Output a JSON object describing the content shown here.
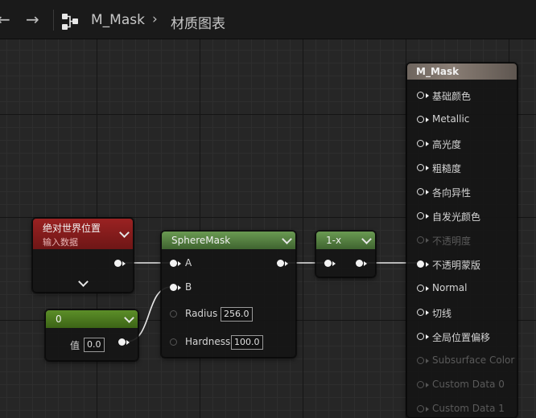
{
  "breadcrumb": {
    "back_icon": "arrow-left-icon",
    "forward_icon": "arrow-right-icon",
    "graph_icon": "graph-nodes-icon",
    "asset_name": "M_Mask",
    "separator": "›",
    "graph_name": "材质图表"
  },
  "nodes": {
    "absolute_world_position": {
      "title": "绝对世界位置",
      "subtitle": "输入数据",
      "header_color": "#8a1d1d"
    },
    "sphere_mask": {
      "title": "SphereMask",
      "header_color": "#4f7a3e",
      "pins": {
        "a": "A",
        "b": "B",
        "radius": "Radius",
        "radius_value": "256.0",
        "hardness": "Hardness",
        "hardness_value": "100.0"
      }
    },
    "constant": {
      "title": "0",
      "value_label": "值",
      "value": "0.0",
      "header_color": "#4c7a20"
    },
    "one_minus": {
      "title": "1-x",
      "header_color": "#4f7a3e"
    },
    "result": {
      "title": "M_Mask",
      "pins": [
        {
          "label": "基础颜色",
          "active": true
        },
        {
          "label": "Metallic",
          "active": true
        },
        {
          "label": "高光度",
          "active": true
        },
        {
          "label": "粗糙度",
          "active": true
        },
        {
          "label": "各向异性",
          "active": true
        },
        {
          "label": "自发光颜色",
          "active": true
        },
        {
          "label": "不透明度",
          "active": false
        },
        {
          "label": "不透明蒙版",
          "active": true,
          "connected": true
        },
        {
          "label": "Normal",
          "active": true
        },
        {
          "label": "切线",
          "active": true
        },
        {
          "label": "全局位置偏移",
          "active": true
        },
        {
          "label": "Subsurface Color",
          "active": false
        },
        {
          "label": "Custom Data 0",
          "active": false
        },
        {
          "label": "Custom Data 1",
          "active": false
        }
      ]
    }
  }
}
